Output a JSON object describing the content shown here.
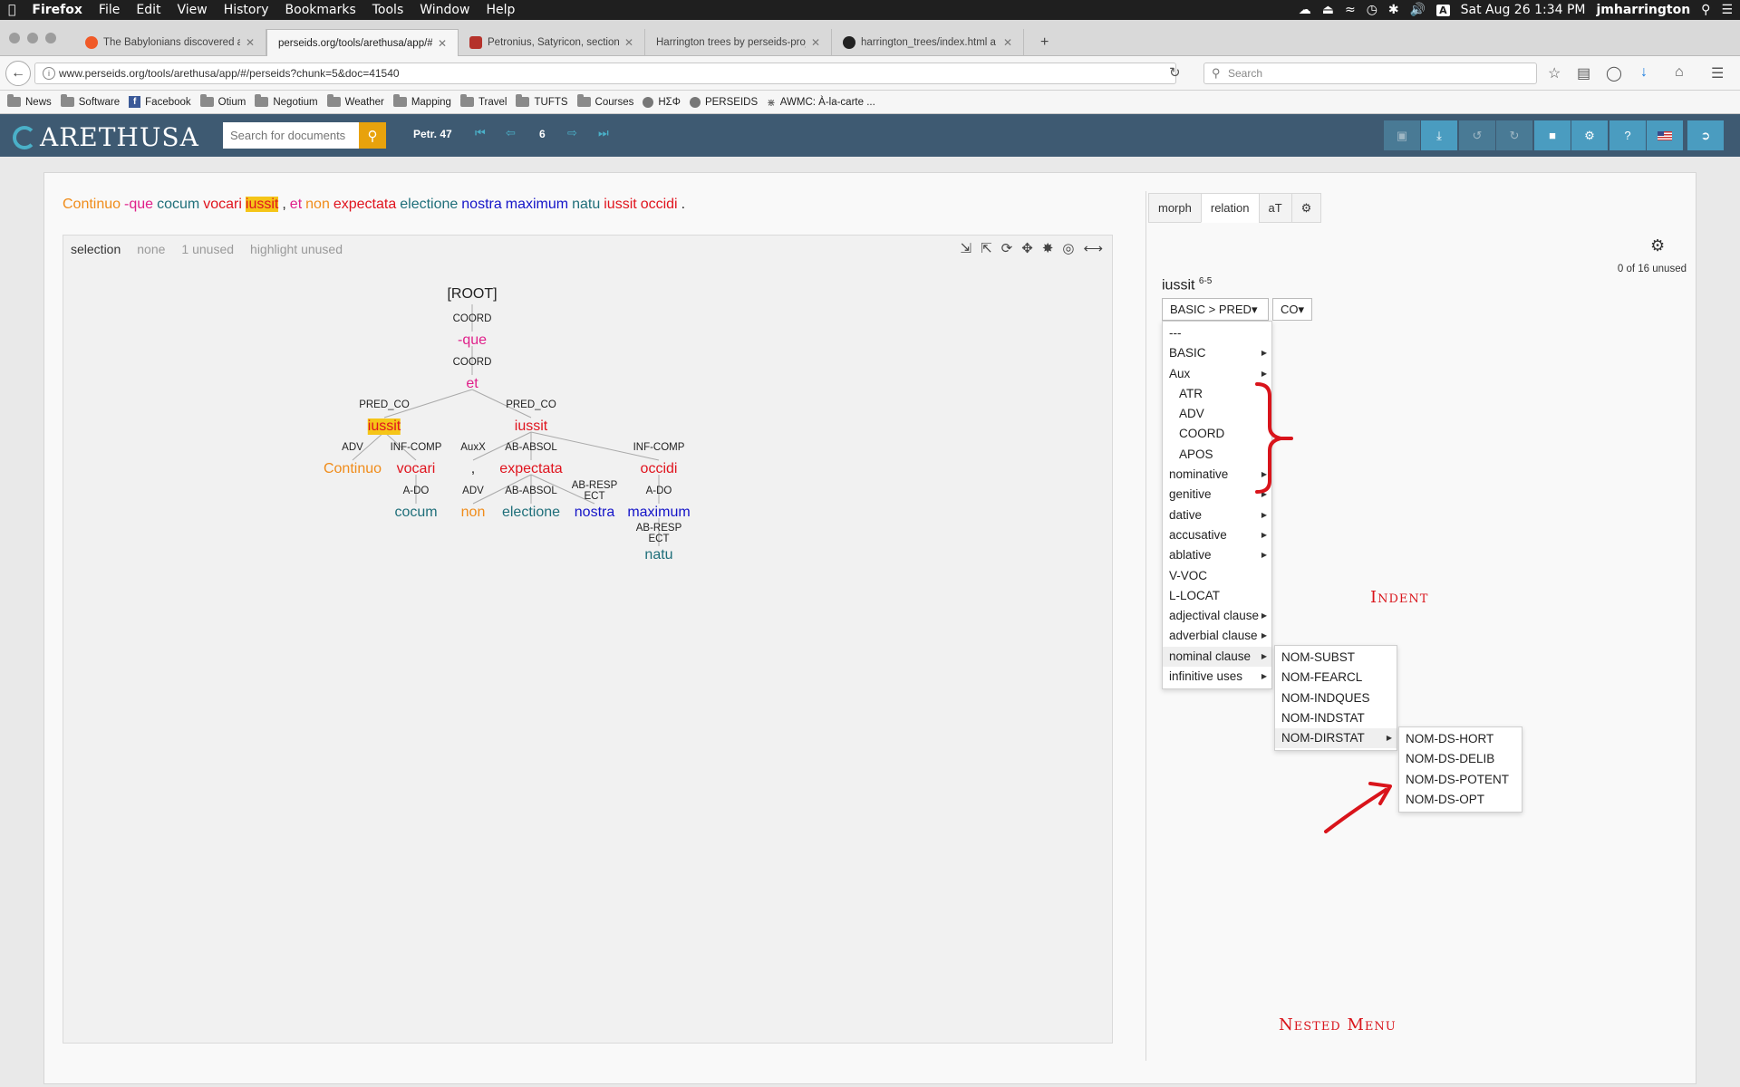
{
  "menubar": {
    "app": "Firefox",
    "items": [
      "File",
      "Edit",
      "View",
      "History",
      "Bookmarks",
      "Tools",
      "Window",
      "Help"
    ],
    "datetime": "Sat Aug 26  1:34 PM",
    "user": "jmharrington"
  },
  "tabs": [
    {
      "label": "The Babylonians discovered a",
      "favcolor": "#f05a28"
    },
    {
      "label": "perseids.org/tools/arethusa/app/#",
      "favcolor": ""
    },
    {
      "label": "Petronius, Satyricon, section",
      "favcolor": "#b5322b"
    },
    {
      "label": "Harrington trees by perseids-proje",
      "favcolor": ""
    },
    {
      "label": "harrington_trees/index.html a",
      "favcolor": "#222222"
    }
  ],
  "nav": {
    "url": "www.perseids.org/tools/arethusa/app/#/perseids?chunk=5&doc=41540",
    "search_placeholder": "Search"
  },
  "bookmarks": [
    "News",
    "Software",
    "Facebook",
    "Otium",
    "Negotium",
    "Weather",
    "Mapping",
    "Travel",
    "TUFTS",
    "Courses",
    "ΗΣΦ",
    "PERSEIDS",
    "AWMC: À-la-carte ..."
  ],
  "arethusa": {
    "logo": "ARETHUSA",
    "doc_search_placeholder": "Search for documents",
    "doc_label": "Petr. 47",
    "page": "6"
  },
  "sentence": [
    {
      "text": "Continuo",
      "color": "#f08c1a"
    },
    {
      "text": "-que",
      "color": "#e0208a"
    },
    {
      "text": "cocum",
      "color": "#1f6f7a"
    },
    {
      "text": "vocari",
      "color": "#e0141e"
    },
    {
      "text": "iussit",
      "color": "#e0141e"
    },
    {
      "text": ",",
      "color": "#222222"
    },
    {
      "text": "et",
      "color": "#e0208a"
    },
    {
      "text": "non",
      "color": "#f08c1a"
    },
    {
      "text": "expectata",
      "color": "#e0141e"
    },
    {
      "text": "electione",
      "color": "#1f6f7a"
    },
    {
      "text": "nostra",
      "color": "#1414c8"
    },
    {
      "text": "maximum",
      "color": "#1414c8"
    },
    {
      "text": "natu",
      "color": "#1f6f7a"
    },
    {
      "text": "iussit",
      "color": "#e0141e"
    },
    {
      "text": "occidi",
      "color": "#e0141e"
    },
    {
      "text": ".",
      "color": "#222222"
    }
  ],
  "tree_modes": [
    "selection",
    "none",
    "1 unused",
    "highlight unused"
  ],
  "tree": {
    "root": "[ROOT]",
    "nodes": [
      {
        "id": "que",
        "word": "-que",
        "label": "COORD",
        "color": "#e0208a"
      },
      {
        "id": "et",
        "word": "et",
        "label": "COORD",
        "color": "#e0208a"
      },
      {
        "id": "iussit1",
        "word": "iussit",
        "label": "PRED_CO",
        "color": "#e0141e",
        "highlight": true
      },
      {
        "id": "iussit2",
        "word": "iussit",
        "label": "PRED_CO",
        "color": "#e0141e"
      },
      {
        "id": "continuo",
        "word": "Continuo",
        "label": "ADV",
        "color": "#f08c1a"
      },
      {
        "id": "vocari",
        "word": "vocari",
        "label": "INF-COMP",
        "color": "#e0141e"
      },
      {
        "id": "comma",
        "word": ",",
        "label": "AuxX",
        "color": "#222222"
      },
      {
        "id": "expectata",
        "word": "expectata",
        "label": "AB-ABSOL",
        "color": "#e0141e"
      },
      {
        "id": "occidi",
        "word": "occidi",
        "label": "INF-COMP",
        "color": "#e0141e"
      },
      {
        "id": "cocum",
        "word": "cocum",
        "label": "A-DO",
        "color": "#1f6f7a"
      },
      {
        "id": "non",
        "word": "non",
        "label": "ADV",
        "color": "#f08c1a"
      },
      {
        "id": "electione",
        "word": "electione",
        "label": "AB-ABSOL",
        "color": "#1f6f7a"
      },
      {
        "id": "nostra",
        "word": "nostra",
        "label": "AB-RESPECT",
        "color": "#1414c8"
      },
      {
        "id": "maximum",
        "word": "maximum",
        "label": "A-DO",
        "color": "#1414c8"
      },
      {
        "id": "natu",
        "word": "natu",
        "label": "AB-RESPECT",
        "color": "#1f6f7a"
      }
    ]
  },
  "right": {
    "tabs": [
      "morph",
      "relation",
      "aT"
    ],
    "unused": "0 of 16 unused",
    "word": "iussit",
    "word_id": "6-5",
    "dropdown1": "BASIC > PRED",
    "dropdown2": "CO",
    "menu1": [
      {
        "label": "---",
        "sub": false,
        "indent": false
      },
      {
        "label": "BASIC",
        "sub": true,
        "indent": false
      },
      {
        "label": "Aux",
        "sub": true,
        "indent": false
      },
      {
        "label": "ATR",
        "sub": false,
        "indent": true
      },
      {
        "label": "ADV",
        "sub": false,
        "indent": true
      },
      {
        "label": "COORD",
        "sub": false,
        "indent": true
      },
      {
        "label": "APOS",
        "sub": false,
        "indent": true
      },
      {
        "label": "nominative",
        "sub": true,
        "indent": false
      },
      {
        "label": "genitive",
        "sub": true,
        "indent": false
      },
      {
        "label": "dative",
        "sub": true,
        "indent": false
      },
      {
        "label": "accusative",
        "sub": true,
        "indent": false
      },
      {
        "label": "ablative",
        "sub": true,
        "indent": false
      },
      {
        "label": "V-VOC",
        "sub": false,
        "indent": false
      },
      {
        "label": "L-LOCAT",
        "sub": false,
        "indent": false
      },
      {
        "label": "adjectival clause",
        "sub": true,
        "indent": false
      },
      {
        "label": "adverbial clause",
        "sub": true,
        "indent": false
      },
      {
        "label": "nominal clause",
        "sub": true,
        "indent": false,
        "hl": true
      },
      {
        "label": "infinitive uses",
        "sub": true,
        "indent": false
      }
    ],
    "menu2": [
      {
        "label": "NOM-SUBST",
        "sub": false
      },
      {
        "label": "NOM-FEARCL",
        "sub": false
      },
      {
        "label": "NOM-INDQUES",
        "sub": false
      },
      {
        "label": "NOM-INDSTAT",
        "sub": false
      },
      {
        "label": "NOM-DIRSTAT",
        "sub": true,
        "hl": true
      }
    ],
    "menu3": [
      {
        "label": "NOM-DS-HORT"
      },
      {
        "label": "NOM-DS-DELIB"
      },
      {
        "label": "NOM-DS-POTENT"
      },
      {
        "label": "NOM-DS-OPT"
      }
    ]
  },
  "annotations": {
    "indent": "Indent",
    "nested": "Nested Menu",
    "color": "#d9141b"
  }
}
